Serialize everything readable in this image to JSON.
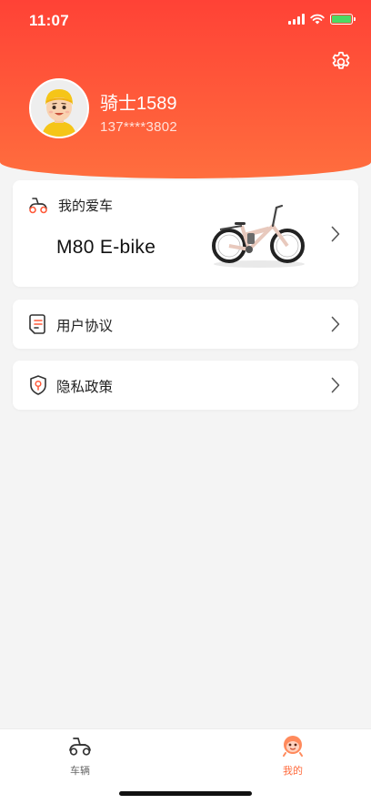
{
  "status_bar": {
    "time": "11:07"
  },
  "profile": {
    "name": "骑士1589",
    "phone": "137****3802"
  },
  "bike_card": {
    "title": "我的爱车",
    "model": "M80 E-bike"
  },
  "menu": [
    {
      "label": "用户协议",
      "icon": "document-icon"
    },
    {
      "label": "隐私政策",
      "icon": "shield-icon"
    }
  ],
  "tabbar": {
    "tabs": [
      {
        "label": "车辆",
        "icon": "scooter-icon",
        "active": false
      },
      {
        "label": "我的",
        "icon": "mascot-icon",
        "active": true
      }
    ]
  },
  "colors": {
    "accent": "#ff5a3a",
    "header_top": "#ff4236",
    "active_tab": "#ff6b3d",
    "background": "#f4f4f4"
  }
}
